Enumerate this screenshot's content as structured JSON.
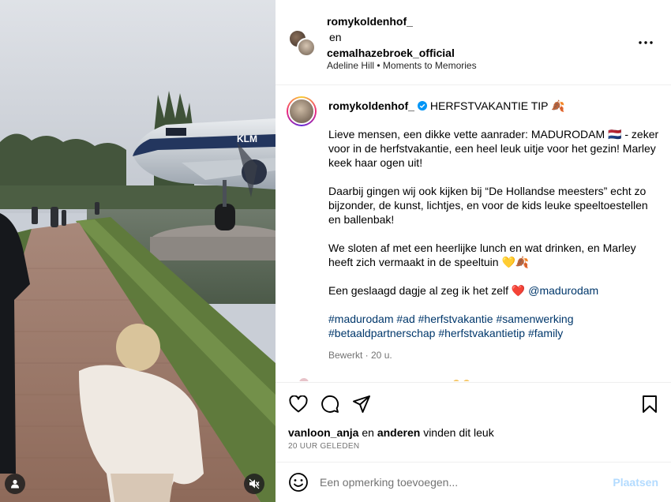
{
  "header": {
    "user1": "romykoldenhof_",
    "conjunction": "en",
    "user2": "cemalhazebroek_official",
    "audio": "Adeline Hill • Moments to Memories",
    "more_icon": "more-horizontal-icon"
  },
  "caption": {
    "username": "romykoldenhof_",
    "verified_icon": "verified-badge-icon",
    "headline": "HERFSTVAKANTIE TIP 🍂",
    "para1": "Lieve mensen, een dikke vette aanrader: MADURODAM 🇳🇱 - zeker voor in de herfstvakantie, een heel leuk uitje voor het gezin! Marley keek haar ogen uit!",
    "para2": "Daarbij gingen wij ook kijken bij “De Hollandse meesters” echt zo bijzonder, de kunst, lichtjes, en voor de kids leuke speeltoestellen en ballenbak!",
    "para3": "We sloten af met een heerlijke lunch en wat drinken, en Marley heeft zich vermaakt in de speeltuin 💛🍂",
    "para4": "Een geslaagd dagje al zeg ik het zelf ❤️",
    "mention": "@madurodam",
    "hashtags": "#madurodam #ad #herfstvakantie #samenwerking #betaaldpartnerschap #herfstvakantietip #family",
    "meta": "Bewerkt · 20 u."
  },
  "actions": {
    "like_icon": "heart-icon",
    "comment_icon": "comment-icon",
    "share_icon": "send-icon",
    "save_icon": "bookmark-icon",
    "liked_by_user": "vanloon_anja",
    "liked_and": "en",
    "liked_others": "anderen",
    "liked_suffix": "vinden dit leuk",
    "time": "20 UUR GELEDEN"
  },
  "comment": {
    "emoji_icon": "emoji-icon",
    "placeholder": "Een opmerking toevoegen...",
    "post_label": "Plaatsen"
  },
  "media": {
    "user_tag_icon": "user-tag-icon",
    "mute_icon": "speaker-muted-icon",
    "plane_livery": "KLM"
  }
}
